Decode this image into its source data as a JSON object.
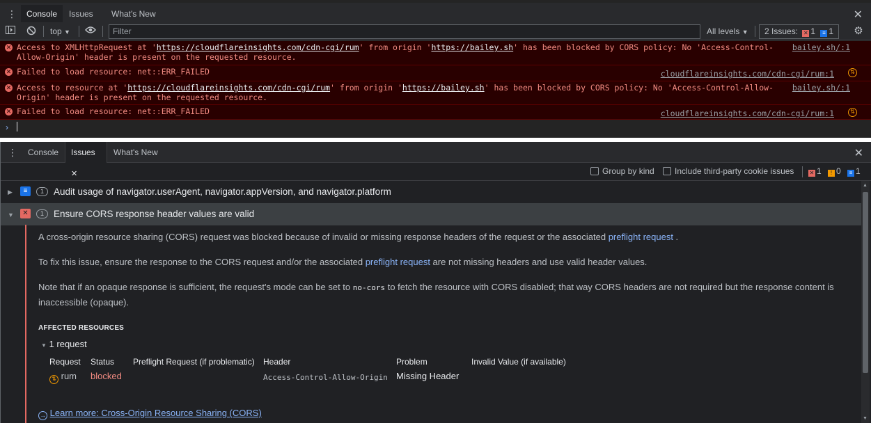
{
  "top_panel": {
    "tabs": [
      "Console",
      "Issues",
      "What's New"
    ],
    "active_tab": "Console",
    "toolbar": {
      "context": "top",
      "filter_placeholder": "Filter",
      "levels": "All levels",
      "issues_label": "2 Issues:",
      "issues_errors": "1",
      "issues_info": "1"
    },
    "messages": [
      {
        "text_pre": "Access to XMLHttpRequest at '",
        "url1": "https://cloudflareinsights.com/cdn-cgi/rum",
        "text_mid": "' from origin '",
        "url2": "https://bailey.sh",
        "text_post": "' has been blocked by CORS policy: No 'Access-Control-Allow-Origin' header is present on the requested resource.",
        "source": "bailey.sh/:1"
      },
      {
        "text": "Failed to load resource: net::ERR_FAILED",
        "source": "cloudflareinsights.com/cdn-cgi/rum:1"
      },
      {
        "text_pre": "Access to resource at '",
        "url1": "https://cloudflareinsights.com/cdn-cgi/rum",
        "text_mid": "' from origin '",
        "url2": "https://bailey.sh",
        "text_post": "' has been blocked by CORS policy: No 'Access-Control-Allow-Origin' header is present on the requested resource.",
        "source": "bailey.sh/:1"
      },
      {
        "text": "Failed to load resource: net::ERR_FAILED",
        "source": "cloudflareinsights.com/cdn-cgi/rum:1"
      }
    ]
  },
  "issues_panel": {
    "tabs": [
      "Console",
      "Issues",
      "What's New"
    ],
    "active_tab": "Issues",
    "toolbar": {
      "group_by_kind": "Group by kind",
      "third_party": "Include third-party cookie issues",
      "count_errors": "1",
      "count_warnings": "0",
      "count_info": "1"
    },
    "issues": [
      {
        "count": "1",
        "title": "Audit usage of navigator.userAgent, navigator.appVersion, and navigator.platform"
      },
      {
        "count": "1",
        "title": "Ensure CORS response header values are valid"
      }
    ],
    "details": {
      "p1_text": "A cross-origin resource sharing (CORS) request was blocked because of invalid or missing response headers of the request or the associated ",
      "p1_link": "preflight request",
      "p1_end": " .",
      "p2_pre": "To fix this issue, ensure the response to the CORS request and/or the associated ",
      "p2_link": "preflight request",
      "p2_post": " are not missing headers and use valid header values.",
      "p3_pre": "Note that if an opaque response is sufficient, the request's mode can be set to ",
      "p3_code": "no-cors",
      "p3_post": " to fetch the resource with CORS disabled; that way CORS headers are not required but the response content is inaccessible (opaque).",
      "affected_title": "AFFECTED RESOURCES",
      "request_count": "1 request",
      "table_headers": [
        "Request",
        "Status",
        "Preflight Request (if problematic)",
        "Header",
        "Problem",
        "Invalid Value (if available)"
      ],
      "row": {
        "request": "rum",
        "status": "blocked",
        "header": "Access-Control-Allow-Origin",
        "problem": "Missing Header"
      },
      "learn_more": "Learn more: Cross-Origin Resource Sharing (CORS)"
    }
  },
  "colors": {
    "error": "#e46962",
    "link": "#8ab4f8",
    "warning": "#f29900",
    "info": "#1a73e8"
  }
}
